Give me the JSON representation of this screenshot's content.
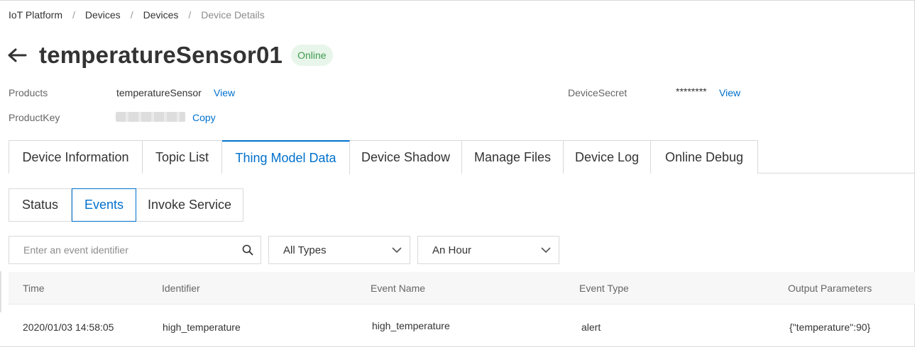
{
  "breadcrumb": {
    "items": [
      "IoT Platform",
      "Devices",
      "Devices",
      "Device Details"
    ],
    "separator": "/"
  },
  "header": {
    "title": "temperatureSensor01",
    "status": "Online",
    "back_icon": "arrow-left-icon"
  },
  "info": {
    "products_label": "Products",
    "products_value": "temperatureSensor",
    "products_link": "View",
    "productkey_label": "ProductKey",
    "productkey_link": "Copy",
    "devicesecret_label": "DeviceSecret",
    "devicesecret_value": "********",
    "devicesecret_link": "View"
  },
  "tabs": [
    {
      "label": "Device Information",
      "active": false
    },
    {
      "label": "Topic List",
      "active": false
    },
    {
      "label": "Thing Model Data",
      "active": true
    },
    {
      "label": "Device Shadow",
      "active": false
    },
    {
      "label": "Manage Files",
      "active": false
    },
    {
      "label": "Device Log",
      "active": false
    },
    {
      "label": "Online Debug",
      "active": false
    }
  ],
  "subtabs": [
    {
      "label": "Status",
      "active": false
    },
    {
      "label": "Events",
      "active": true
    },
    {
      "label": "Invoke Service",
      "active": false
    }
  ],
  "filters": {
    "search_placeholder": "Enter an event identifier",
    "search_value": "",
    "type_selected": "All Types",
    "time_selected": "An Hour"
  },
  "table": {
    "columns": [
      "Time",
      "Identifier",
      "Event Name",
      "Event Type",
      "Output Parameters"
    ],
    "rows": [
      [
        "2020/01/03 14:58:05",
        "high_temperature",
        "high_temperature",
        "alert",
        "{\"temperature\":90}"
      ]
    ]
  },
  "colors": {
    "accent": "#0070cc",
    "online_bg": "#e8f5ea",
    "online_text": "#3d9a4e",
    "border": "#d9d9d9"
  }
}
